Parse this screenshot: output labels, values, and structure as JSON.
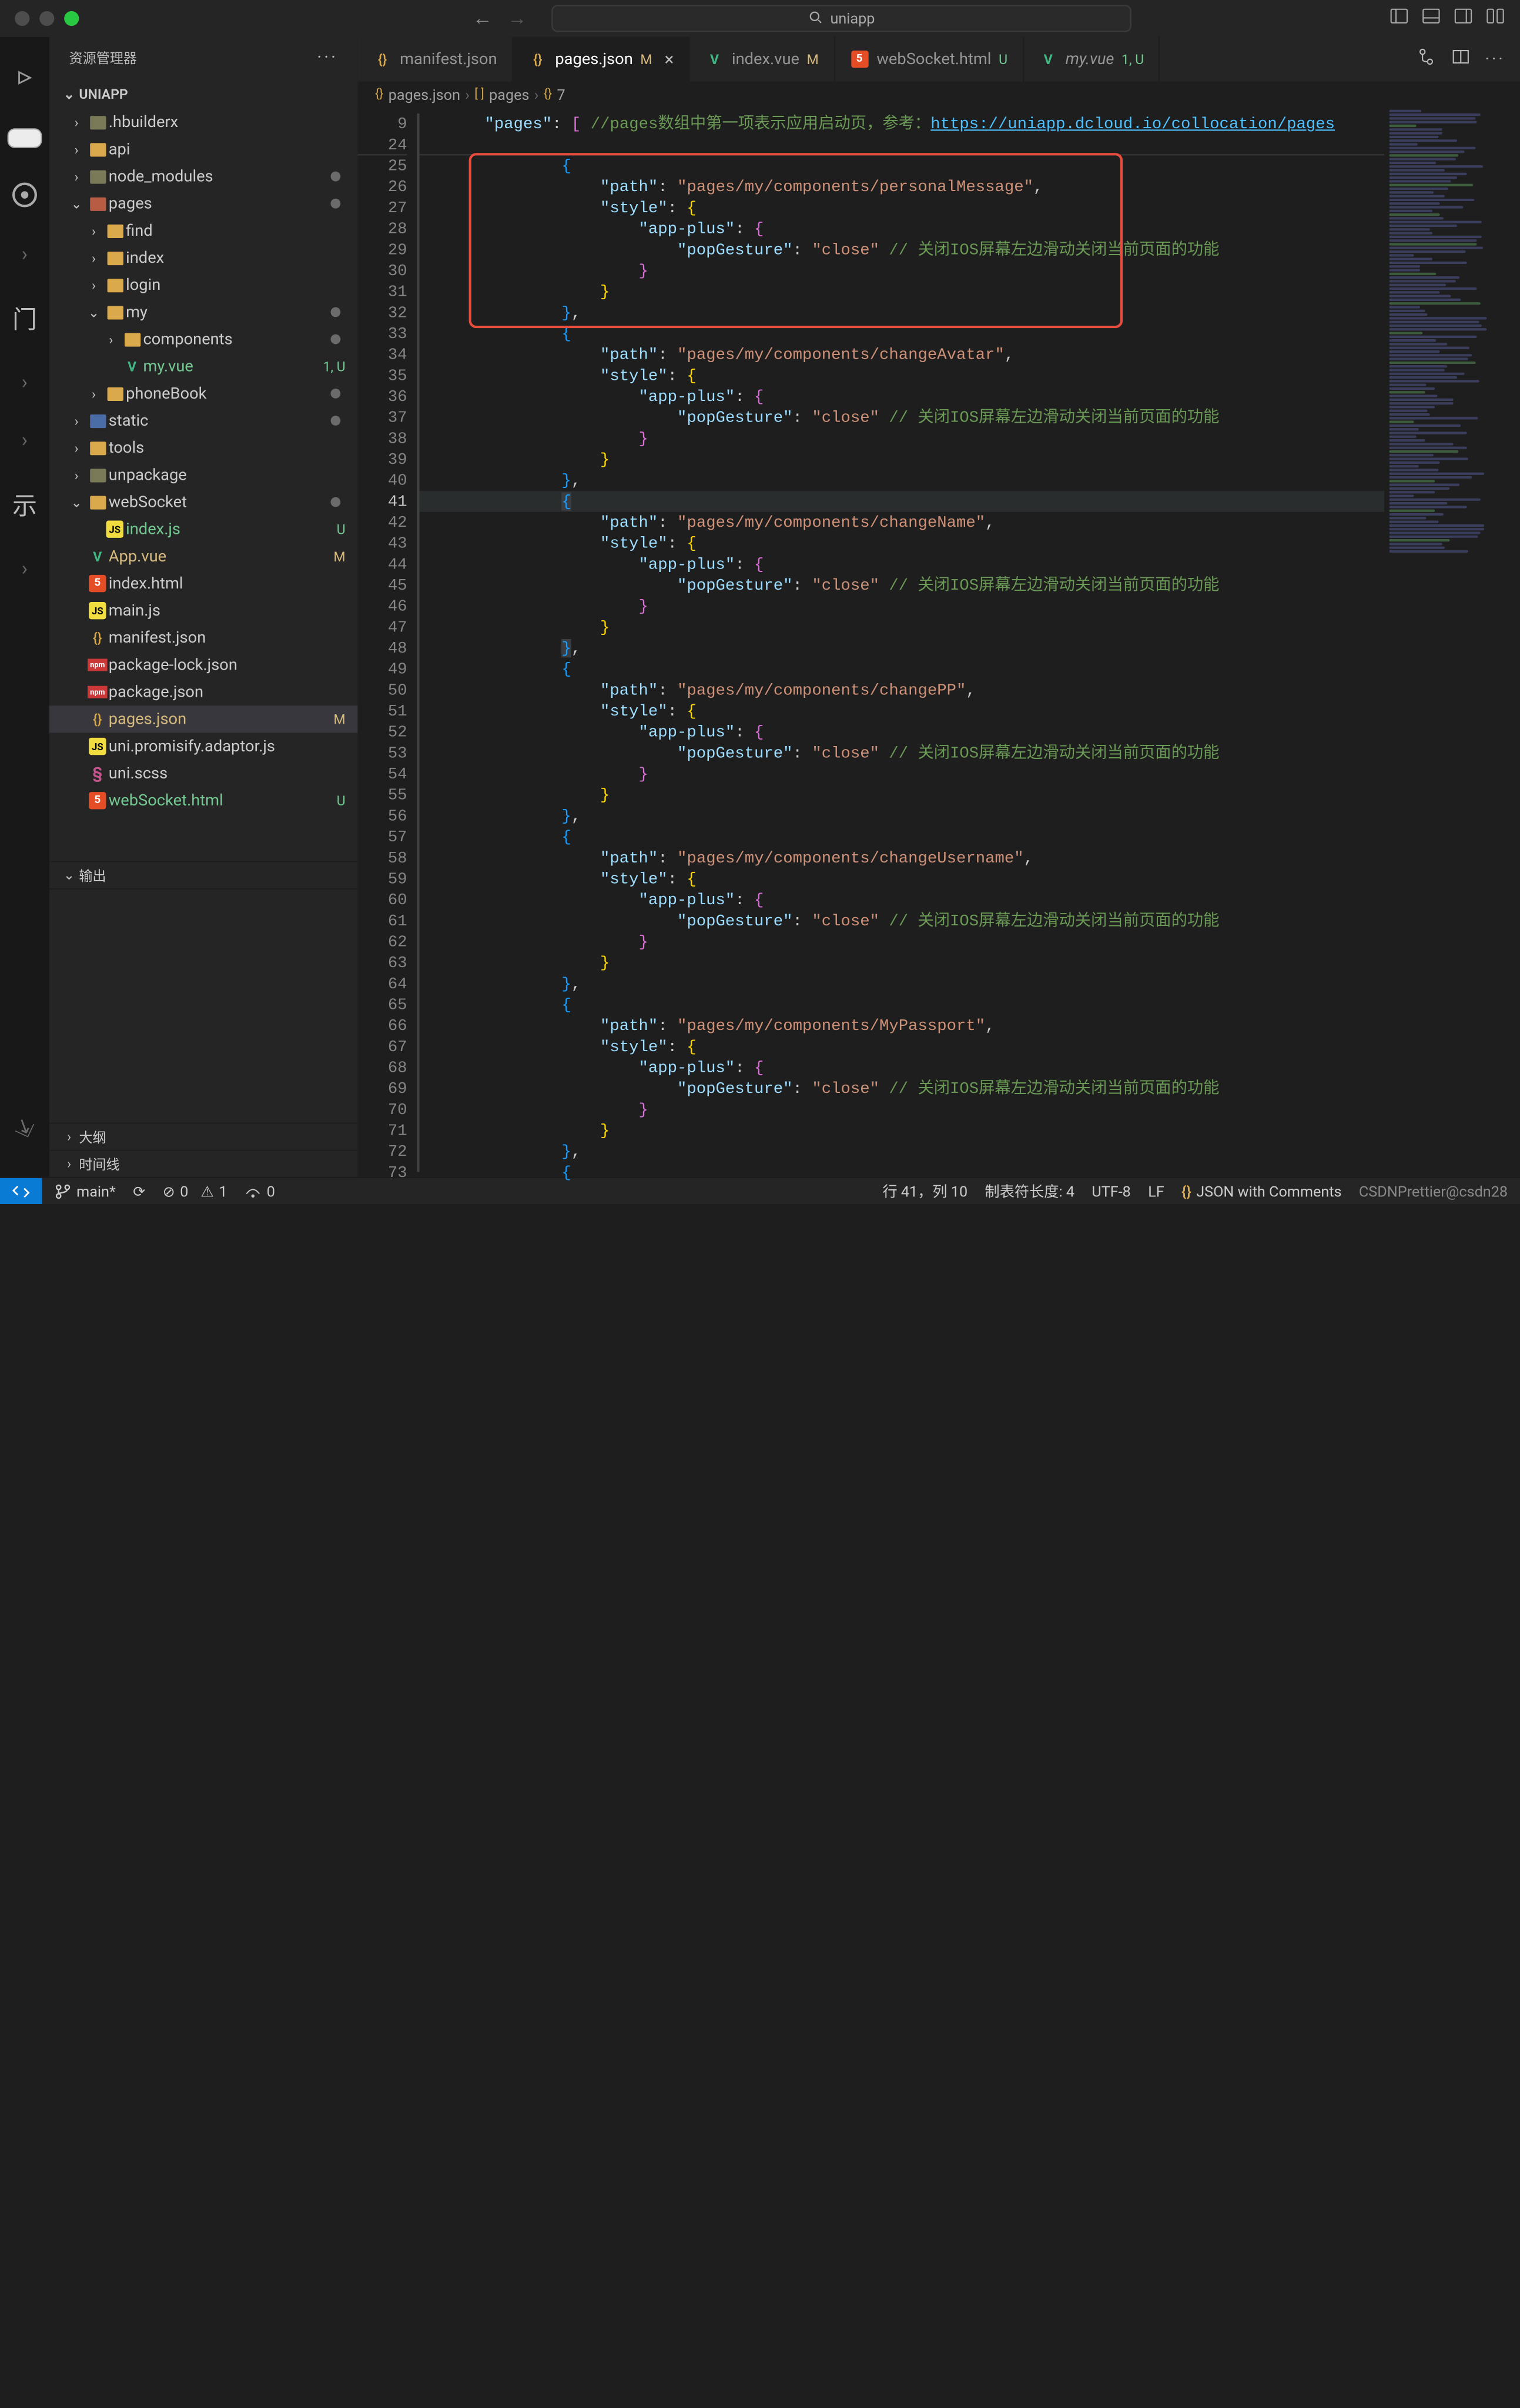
{
  "title_search": "uniapp",
  "sidebar": {
    "title": "资源管理器",
    "project": "UNIAPP",
    "tree": [
      {
        "depth": 0,
        "twisty": ">",
        "icon": "fold-dim",
        "name": ".hbuilderx",
        "dot": false
      },
      {
        "depth": 0,
        "twisty": ">",
        "icon": "fold-yellow",
        "name": "api",
        "dot": false
      },
      {
        "depth": 0,
        "twisty": ">",
        "icon": "fold-dim",
        "name": "node_modules",
        "dot": true
      },
      {
        "depth": 0,
        "twisty": "v",
        "icon": "fold-red",
        "name": "pages",
        "dot": true
      },
      {
        "depth": 1,
        "twisty": ">",
        "icon": "fold-yellow",
        "name": "find",
        "dot": false
      },
      {
        "depth": 1,
        "twisty": ">",
        "icon": "fold-yellow",
        "name": "index",
        "dot": false
      },
      {
        "depth": 1,
        "twisty": ">",
        "icon": "fold-yellow",
        "name": "login",
        "dot": false
      },
      {
        "depth": 1,
        "twisty": "v",
        "icon": "fold-yellow",
        "name": "my",
        "dot": true
      },
      {
        "depth": 2,
        "twisty": ">",
        "icon": "fold-yellow",
        "name": "components",
        "dot": true
      },
      {
        "depth": 2,
        "twisty": "",
        "icon": "file-vue",
        "name": "my.vue",
        "mod": "1, U",
        "modClass": "U",
        "colClass": "u-col"
      },
      {
        "depth": 1,
        "twisty": ">",
        "icon": "fold-yellow",
        "name": "phoneBook",
        "dot": true
      },
      {
        "depth": 0,
        "twisty": ">",
        "icon": "fold-blue",
        "name": "static",
        "dot": true
      },
      {
        "depth": 0,
        "twisty": ">",
        "icon": "fold-yellow",
        "name": "tools",
        "dot": false
      },
      {
        "depth": 0,
        "twisty": ">",
        "icon": "fold-dim",
        "name": "unpackage",
        "dot": false
      },
      {
        "depth": 0,
        "twisty": "v",
        "icon": "fold-yellow",
        "name": "webSocket",
        "dot": true
      },
      {
        "depth": 1,
        "twisty": "",
        "icon": "file-js",
        "name": "index.js",
        "mod": "U",
        "modClass": "U",
        "colClass": "u-col"
      },
      {
        "depth": 0,
        "twisty": "",
        "icon": "file-vue",
        "name": "App.vue",
        "mod": "M",
        "modClass": "M",
        "colClass": "m-col"
      },
      {
        "depth": 0,
        "twisty": "",
        "icon": "file-html",
        "name": "index.html",
        "dot": false
      },
      {
        "depth": 0,
        "twisty": "",
        "icon": "file-js",
        "name": "main.js",
        "dot": false
      },
      {
        "depth": 0,
        "twisty": "",
        "icon": "file-braces",
        "name": "manifest.json",
        "dot": false
      },
      {
        "depth": 0,
        "twisty": "",
        "icon": "file-npm",
        "name": "package-lock.json",
        "dot": false
      },
      {
        "depth": 0,
        "twisty": "",
        "icon": "file-npm",
        "name": "package.json",
        "dot": false
      },
      {
        "depth": 0,
        "twisty": "",
        "icon": "file-braces",
        "name": "pages.json",
        "mod": "M",
        "modClass": "M",
        "colClass": "m-col",
        "active": true
      },
      {
        "depth": 0,
        "twisty": "",
        "icon": "file-js",
        "name": "uni.promisify.adaptor.js",
        "dot": false
      },
      {
        "depth": 0,
        "twisty": "",
        "icon": "file-scss",
        "name": "uni.scss",
        "dot": false
      },
      {
        "depth": 0,
        "twisty": "",
        "icon": "file-html",
        "name": "webSocket.html",
        "mod": "U",
        "modClass": "U",
        "colClass": "u-col"
      }
    ],
    "output_label": "输出",
    "outline_label": "大纲",
    "timeline_label": "时间线"
  },
  "tabs": [
    {
      "icon": "file-braces",
      "label": "manifest.json",
      "suffix": "",
      "active": false
    },
    {
      "icon": "file-braces",
      "label": "pages.json",
      "suffix": "M",
      "suffixClass": "M",
      "active": true,
      "close": true
    },
    {
      "icon": "file-vue",
      "label": "index.vue",
      "suffix": "M",
      "suffixClass": "M",
      "active": false
    },
    {
      "icon": "file-html",
      "label": "webSocket.html",
      "suffix": "U",
      "suffixClass": "U",
      "active": false
    },
    {
      "icon": "file-vue",
      "label": "my.vue",
      "suffix": "1, U",
      "suffixClass": "U",
      "italic": true,
      "active": false
    }
  ],
  "breadcrumb": [
    {
      "icon": "{}",
      "text": "pages.json"
    },
    {
      "icon": "[ ]",
      "text": "pages"
    },
    {
      "icon": "{}",
      "text": "7"
    }
  ],
  "editor": {
    "first_line_no": 9,
    "active_line_no": 41,
    "comment_prefix": "//pages数组中第一项表示应用启动页，参考：",
    "comment_link": "https://uniapp.dcloud.io/collocation/pages",
    "close_comment": " // 关闭IOS屏幕左边滑动关闭当前页面的功能",
    "blocks": [
      {
        "path": "pages/my/components/personalMessage",
        "highlight": true
      },
      {
        "path": "pages/my/components/changeAvatar"
      },
      {
        "path": "pages/my/components/changeName",
        "caret": true
      },
      {
        "path": "pages/my/components/changePP"
      },
      {
        "path": "pages/my/components/changeUsername"
      },
      {
        "path": "pages/my/components/MyPassport"
      }
    ]
  },
  "statusbar": {
    "branch": "main*",
    "sync": "⟳",
    "errors": "0",
    "warnings": "1",
    "port": "0",
    "cursor": "行 41，列 10",
    "tabsize": "制表符长度: 4",
    "encoding": "UTF-8",
    "eol": "LF",
    "lang_icon": "{}",
    "lang": "JSON with Comments",
    "prettier": "CSDNPrettier@csdn28"
  }
}
